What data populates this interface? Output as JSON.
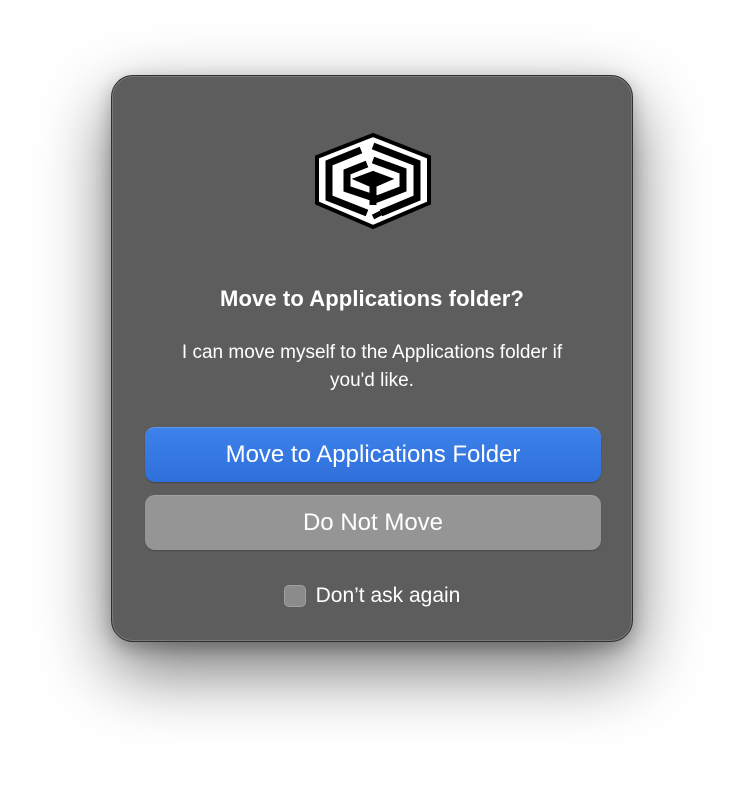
{
  "dialog": {
    "icon": "app-logo-icon",
    "title": "Move to Applications folder?",
    "message": "I can move myself to the Applications folder if you'd like.",
    "primary_button_label": "Move to Applications Folder",
    "secondary_button_label": "Do Not Move",
    "checkbox_label": "Don’t ask again",
    "checkbox_checked": false
  },
  "colors": {
    "dialog_background": "#5d5d5d",
    "primary_button": "#3478e5",
    "secondary_button": "#959595",
    "text": "#ffffff"
  }
}
